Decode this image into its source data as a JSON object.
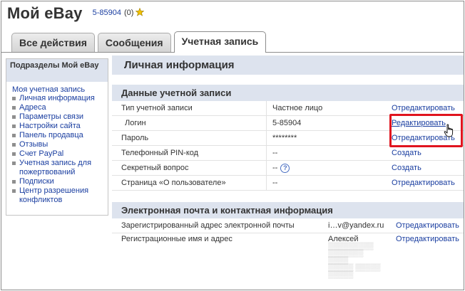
{
  "header": {
    "title": "Мой eBay",
    "user_id": "5-85904",
    "feedback": "(0)"
  },
  "tabs": [
    {
      "label": "Все действия"
    },
    {
      "label": "Сообщения"
    },
    {
      "label": "Учетная запись"
    }
  ],
  "sidebar": {
    "heading": "Подразделы Мой eBay",
    "subheading": "Моя учетная запись",
    "items": [
      {
        "label": "Личная информация"
      },
      {
        "label": "Адреса"
      },
      {
        "label": "Параметры связи"
      },
      {
        "label": "Настройки сайта"
      },
      {
        "label": "Панель продавца"
      },
      {
        "label": "Отзывы"
      },
      {
        "label": "Счет PayPal"
      },
      {
        "label": "Учетная запись для пожертвований"
      },
      {
        "label": "Подписки"
      },
      {
        "label": "Центр разрешения конфликтов"
      }
    ]
  },
  "main": {
    "page_title": "Личная информация",
    "account_section": {
      "title": "Данные учетной записи",
      "rows": [
        {
          "label": "Тип учетной записи",
          "value": "Частное лицо",
          "action": "Отредактировать"
        },
        {
          "label": "Логин",
          "value": "5-85904",
          "action": "Редактировать"
        },
        {
          "label": "Пароль",
          "value": "********",
          "action": "Отредактировать"
        },
        {
          "label": "Телефонный PIN-код",
          "value": "--",
          "action": "Создать"
        },
        {
          "label": "Секретный вопрос",
          "value": "--",
          "help": "?",
          "action": "Создать"
        },
        {
          "label": "Страница «О пользователе»",
          "value": "--",
          "action": "Отредактировать"
        }
      ]
    },
    "contact_section": {
      "title": "Электронная почта и контактная информация",
      "rows": [
        {
          "label": "Зарегистрированный адрес электронной почты",
          "value": "i…v@yandex.ru",
          "action": "Отредактировать"
        },
        {
          "label": "Регистрационные имя и адрес",
          "value": "Алексей",
          "action": "Отредактировать"
        }
      ]
    }
  },
  "colors": {
    "link": "#1a3ea0",
    "section_header_bg": "#dde3ee",
    "highlight": "#e0141e"
  },
  "icons": {
    "star": "star-icon",
    "cursor": "hand-cursor-icon",
    "help": "help-icon"
  }
}
